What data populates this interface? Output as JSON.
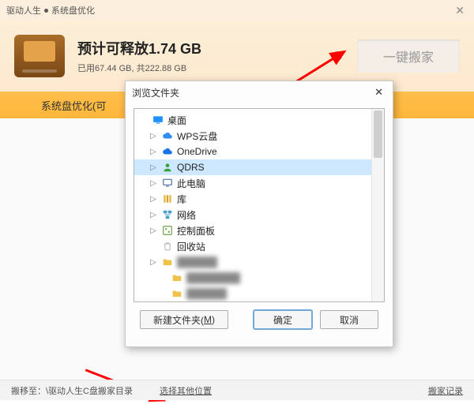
{
  "titlebar": {
    "app_name": "驱动人生",
    "page_name": "系统盘优化"
  },
  "header": {
    "headline_prefix": "预计可释放",
    "headline_value": "1.74 GB",
    "usage_line": "已用67.44 GB, 共222.88 GB",
    "move_button_label": "一键搬家"
  },
  "optimize_bar": {
    "text": "系统盘优化(可"
  },
  "footer": {
    "moveto_label": "搬移至：",
    "moveto_path": "\\驱动人生C盘搬家目录",
    "choose_other": "选择其他位置",
    "history": "搬家记录"
  },
  "dialog": {
    "title": "浏览文件夹",
    "new_folder_label": "新建文件夹(",
    "new_folder_hotkey": "M",
    "new_folder_label_end": ")",
    "ok_label": "确定",
    "cancel_label": "取消",
    "tree": [
      {
        "id": "desktop",
        "level": 0,
        "expander": "",
        "icon": "desktop",
        "label": "桌面",
        "selected": false,
        "blurred": false
      },
      {
        "id": "wpscloud",
        "level": 1,
        "expander": ">",
        "icon": "cloud",
        "label": "WPS云盘",
        "selected": false,
        "blurred": false
      },
      {
        "id": "onedrive",
        "level": 1,
        "expander": ">",
        "icon": "onedrive",
        "label": "OneDrive",
        "selected": false,
        "blurred": false
      },
      {
        "id": "qdrs",
        "level": 1,
        "expander": ">",
        "icon": "user",
        "label": "QDRS",
        "selected": true,
        "blurred": false
      },
      {
        "id": "thispc",
        "level": 1,
        "expander": ">",
        "icon": "pc",
        "label": "此电脑",
        "selected": false,
        "blurred": false
      },
      {
        "id": "libraries",
        "level": 1,
        "expander": ">",
        "icon": "lib",
        "label": "库",
        "selected": false,
        "blurred": false
      },
      {
        "id": "network",
        "level": 1,
        "expander": ">",
        "icon": "network",
        "label": "网络",
        "selected": false,
        "blurred": false
      },
      {
        "id": "control",
        "level": 1,
        "expander": ">",
        "icon": "control",
        "label": "控制面板",
        "selected": false,
        "blurred": false
      },
      {
        "id": "recycle",
        "level": 1,
        "expander": "",
        "icon": "recycle",
        "label": "回收站",
        "selected": false,
        "blurred": false
      },
      {
        "id": "blur1",
        "level": 1,
        "expander": ">",
        "icon": "folder",
        "label": "██████",
        "selected": false,
        "blurred": true
      },
      {
        "id": "blur2",
        "level": 2,
        "expander": "",
        "icon": "folder",
        "label": "████████",
        "selected": false,
        "blurred": true
      },
      {
        "id": "blur3",
        "level": 2,
        "expander": "",
        "icon": "folder",
        "label": "██████",
        "selected": false,
        "blurred": true
      }
    ]
  },
  "icons": {
    "desktop": {
      "bg": "#1e90ff"
    },
    "cloud": {
      "bg": "#2f8ef0"
    },
    "onedrive": {
      "bg": "#1a73e8"
    },
    "user": {
      "bg": "#3aa03a"
    },
    "pc": {
      "bg": "#4a6fa5"
    },
    "lib": {
      "bg": "#e7b53d"
    },
    "network": {
      "bg": "#4aa0c8"
    },
    "control": {
      "bg": "#6ca04a"
    },
    "recycle": {
      "bg": "#bfbfbf"
    },
    "folder": {
      "bg": "#f0c24a"
    }
  }
}
